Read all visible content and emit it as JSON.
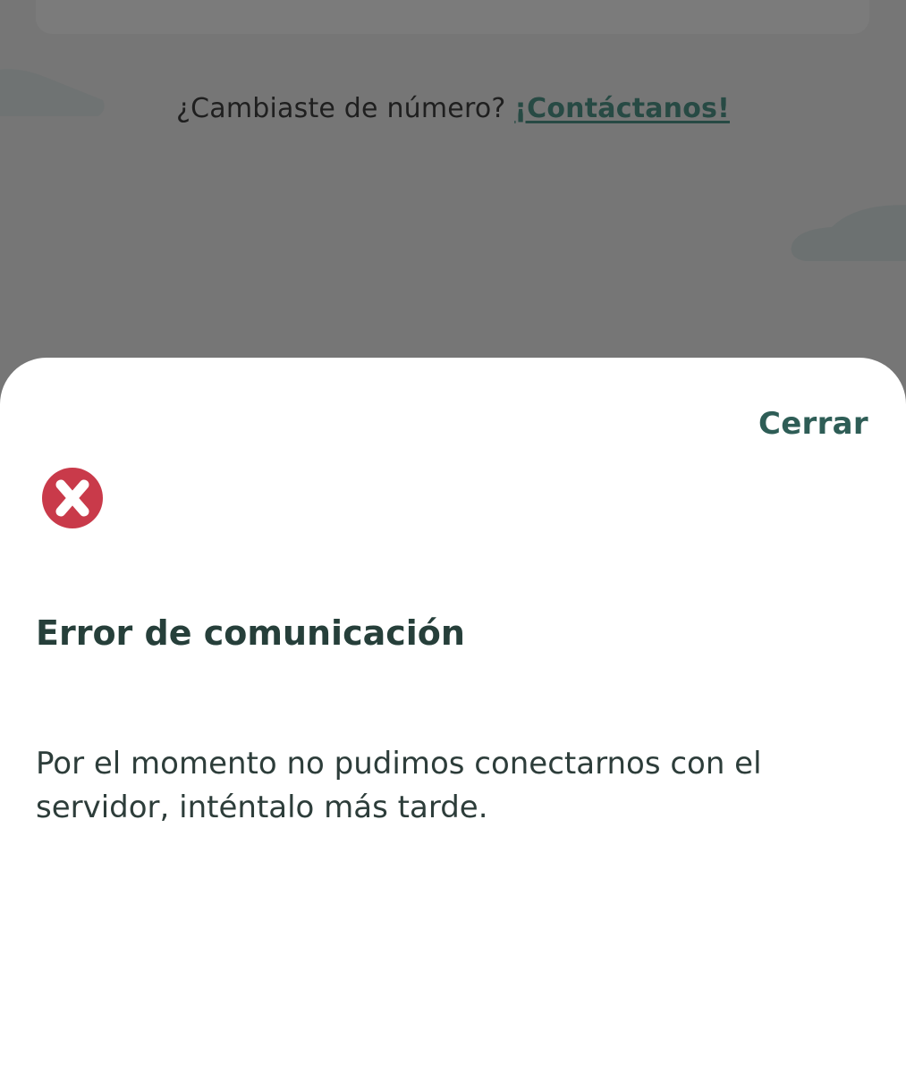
{
  "background": {
    "change_number_question": "¿Cambiaste de número?",
    "contact_link": "¡Contáctanos!"
  },
  "dialog": {
    "close_label": "Cerrar",
    "icon": "error-x-icon",
    "title": "Error de comunicación",
    "message": "Por el momento no pudimos conectarnos con el servidor, inténtalo más tarde."
  },
  "colors": {
    "overlay": "#767676",
    "accent": "#2e5d56",
    "error_red": "#c93a4a",
    "title_text": "#263f3a"
  }
}
